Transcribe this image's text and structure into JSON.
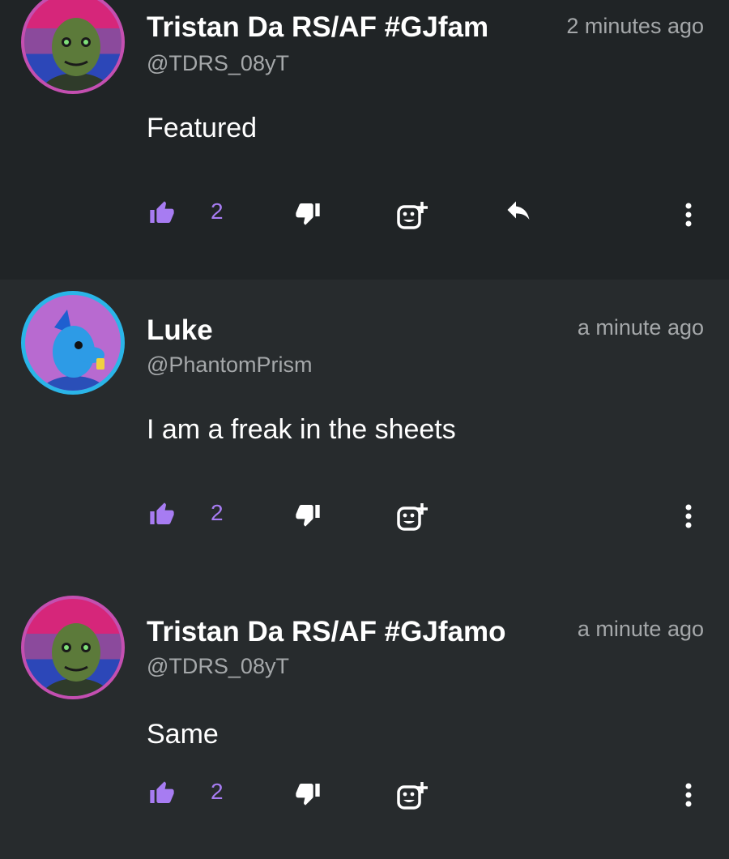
{
  "comments": [
    {
      "name": "Tristan Da RS/AF #GJfam",
      "handle": "@TDRS_08yT",
      "time": "2 minutes ago",
      "text": "Featured",
      "likes": "2",
      "has_reply": true
    },
    {
      "name": "Luke",
      "handle": "@PhantomPrism",
      "time": "a minute ago",
      "text": "I am a freak in the sheets",
      "likes": "2",
      "has_reply": false
    },
    {
      "name": "Tristan Da RS/AF #GJfamo",
      "handle": "@TDRS_08yT",
      "time": "a minute ago",
      "text": "Same",
      "likes": "2",
      "has_reply": false
    }
  ],
  "colors": {
    "accent": "#a77cf2",
    "muted_text": "#a5a8aa",
    "background": "#272b2d",
    "featured_background": "#202426"
  },
  "icons": [
    "thumbs-up-icon",
    "thumbs-down-icon",
    "add-reaction-icon",
    "reply-icon",
    "more-vertical-icon"
  ]
}
